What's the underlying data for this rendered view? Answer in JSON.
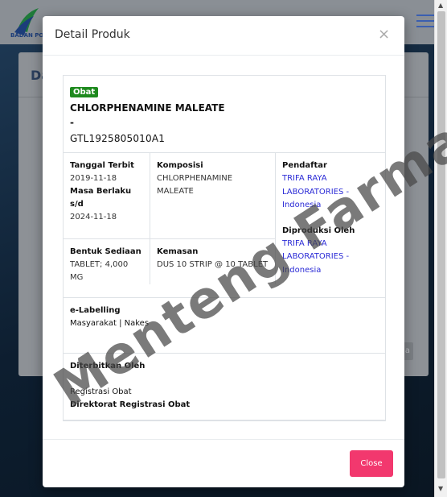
{
  "background": {
    "logo_text": "BADAN POM",
    "card_title": "Da",
    "card_button": "a"
  },
  "modal": {
    "title": "Detail Produk",
    "close_x": "×",
    "badge": "Obat",
    "product_name": "CHLORPHENAMINE MALEATE",
    "product_dash": "-",
    "product_code": "GTL1925805010A1",
    "fields": {
      "tanggal_terbit_label": "Tanggal Terbit",
      "tanggal_terbit_value": "2019-11-18",
      "masa_berlaku_label": "Masa Berlaku s/d",
      "masa_berlaku_value": "2024-11-18",
      "komposisi_label": "Komposisi",
      "komposisi_value": "CHLORPHENAMINE MALEATE",
      "pendaftar_label": "Pendaftar",
      "pendaftar_value": "TRIFA RAYA LABORATORIES - Indonesia",
      "diproduksi_label": "Diproduksi Oleh",
      "diproduksi_value": "TRIFA RAYA LABORATORIES - Indonesia",
      "bentuk_label": "Bentuk Sediaan",
      "bentuk_value": "TABLET; 4,000 MG",
      "kemasan_label": "Kemasan",
      "kemasan_value": "DUS 10 STRIP @ 10 TABLET"
    },
    "elabelling_label": "e-Labelling",
    "elabelling_value": "Masyarakat | Nakes",
    "diterbitkan_label": "Diterbitkan Oleh",
    "diterbitkan_line1": "Registrasi Obat",
    "diterbitkan_line2": "Direktorat Registrasi Obat",
    "close_button": "Close"
  },
  "watermark": "Menteng Farma",
  "colors": {
    "badge": "#1e8a1e",
    "link": "#2b2bd6",
    "close_button": "#f2386e"
  }
}
